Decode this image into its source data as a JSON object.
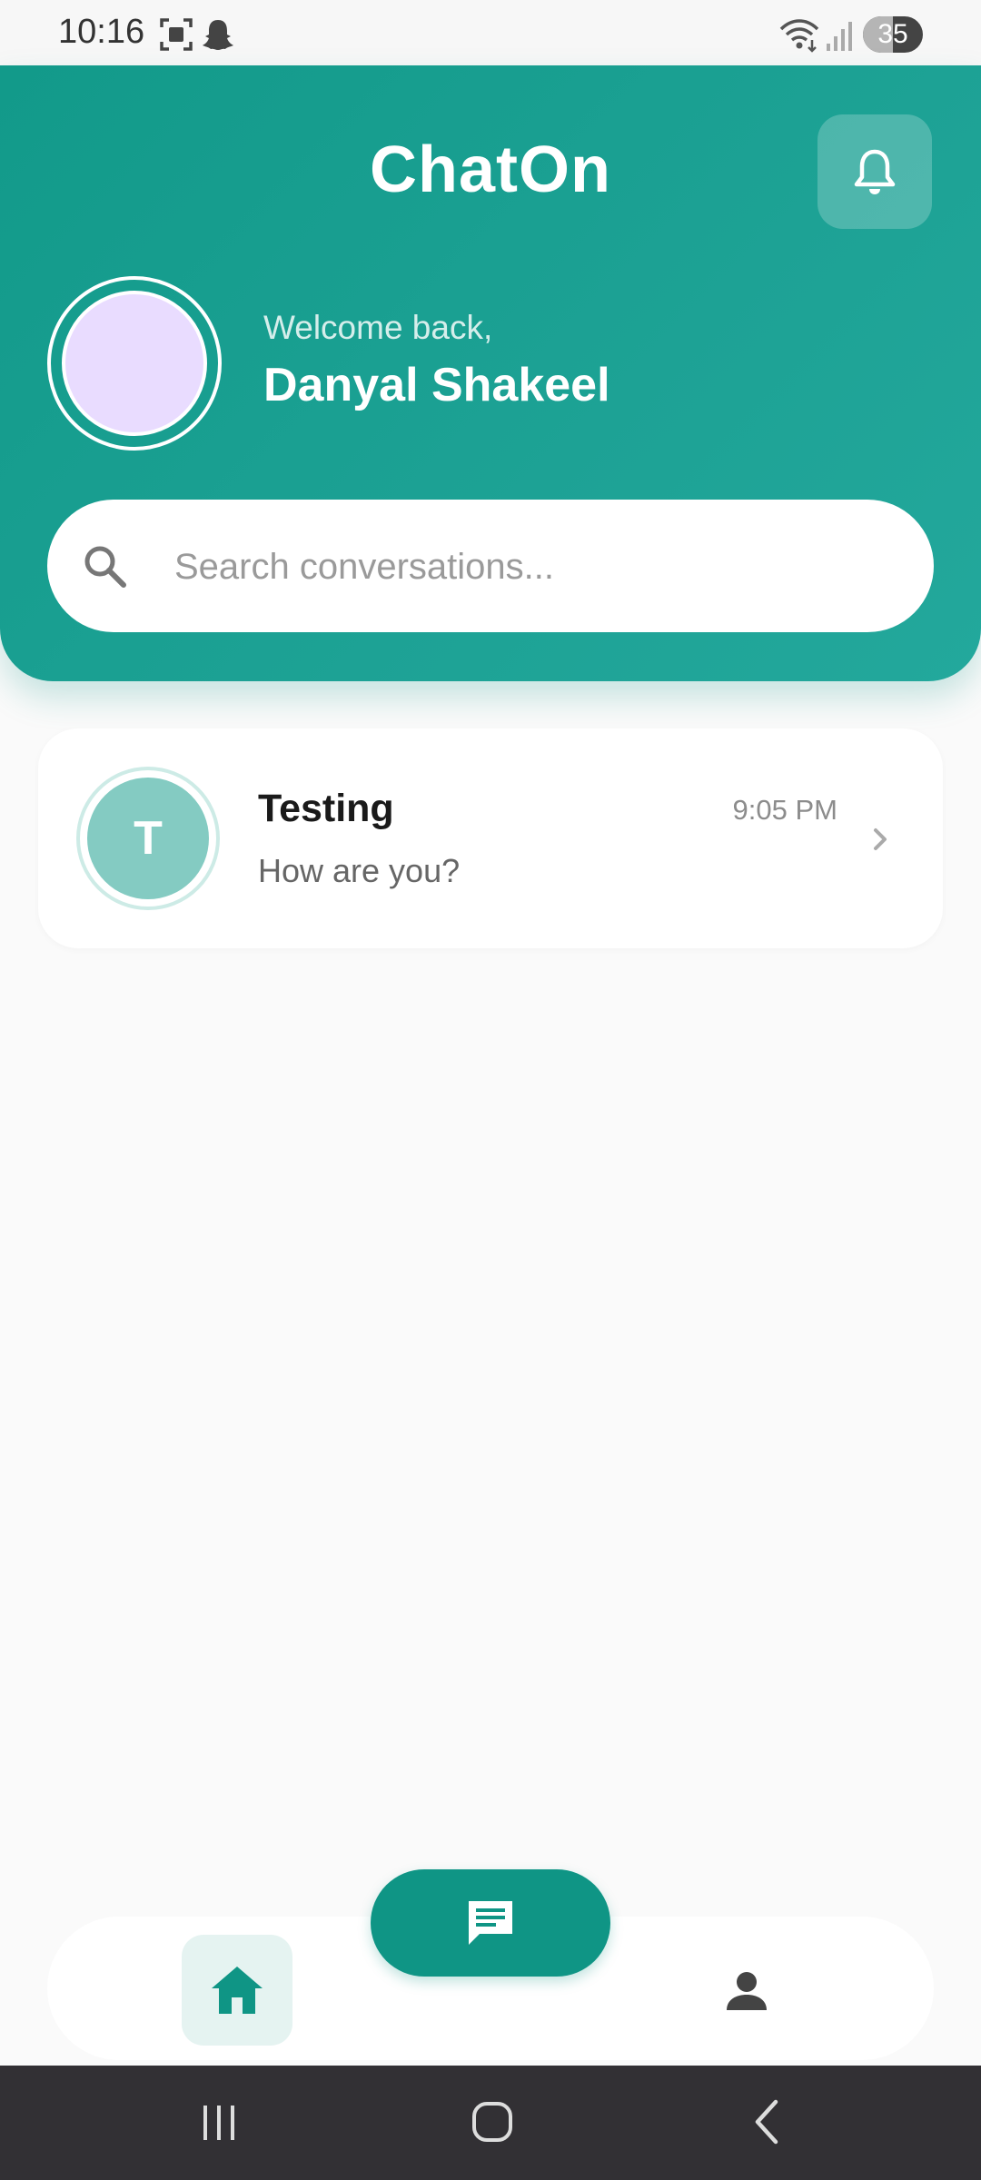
{
  "status_bar": {
    "time": "10:16",
    "battery": "35",
    "icons": [
      "screenshot-icon",
      "snapchat-icon",
      "wifi-icon",
      "signal-icon",
      "battery-icon"
    ]
  },
  "header": {
    "title": "ChatOn",
    "welcome": "Welcome back,",
    "username": "Danyal Shakeel",
    "avatar_color": "#e9dcff",
    "accent": "#129a8a"
  },
  "search": {
    "placeholder": "Search conversations...",
    "value": ""
  },
  "conversations": [
    {
      "initial": "T",
      "name": "Testing",
      "time": "9:05 PM",
      "last_message": "How are you?",
      "avatar_color": "#84cbc2"
    }
  ],
  "bottom_nav": {
    "items": [
      "home-icon",
      "chat-icon",
      "profile-icon"
    ],
    "active": "home"
  },
  "system_nav": [
    "recents-icon",
    "home-button-icon",
    "back-icon"
  ]
}
